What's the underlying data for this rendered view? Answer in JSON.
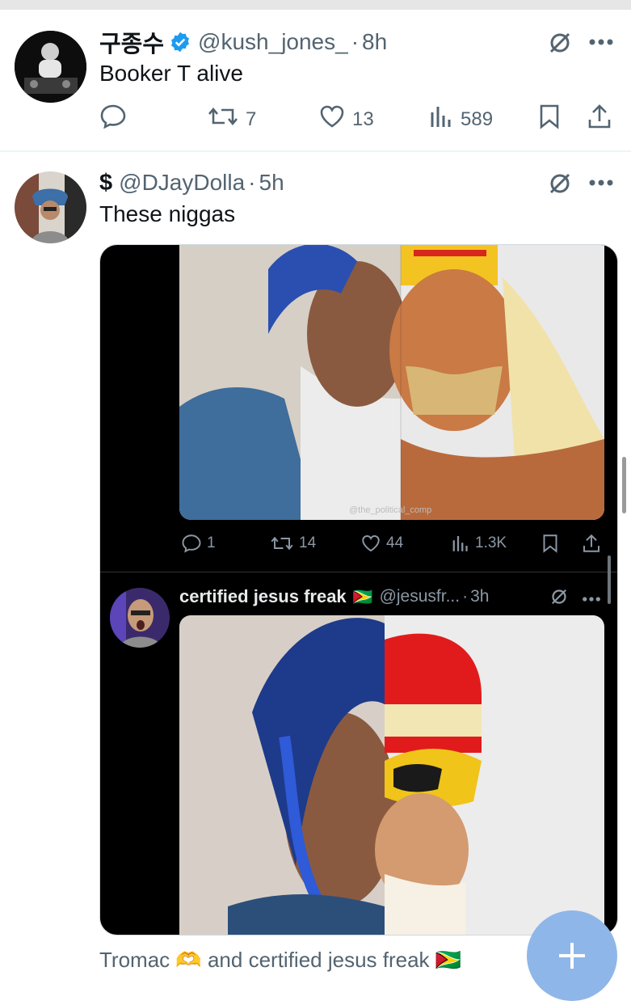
{
  "tweet1": {
    "display_name": "구종수",
    "handle": "@kush_jones_",
    "time": "8h",
    "text": "Booker T alive",
    "retweets": "7",
    "likes": "13",
    "views": "589"
  },
  "tweet2": {
    "display_name": "$",
    "handle": "@DJayDolla",
    "time": "5h",
    "text": "These niggas",
    "media": {
      "watermark": "@the_political_comp",
      "inner_replies": "1",
      "inner_retweets": "14",
      "inner_likes": "44",
      "inner_views": "1.3K",
      "quoted": {
        "display_name": "certified jesus freak",
        "flag": "🇬🇾",
        "handle": "@jesusfr...",
        "time": "3h"
      }
    }
  },
  "footer_text": "Tromac 🫶 and certified jesus freak 🇬🇾",
  "colors": {
    "verified": "#1d9bf0",
    "fab": "#8fb6e8",
    "muted": "#536471"
  }
}
